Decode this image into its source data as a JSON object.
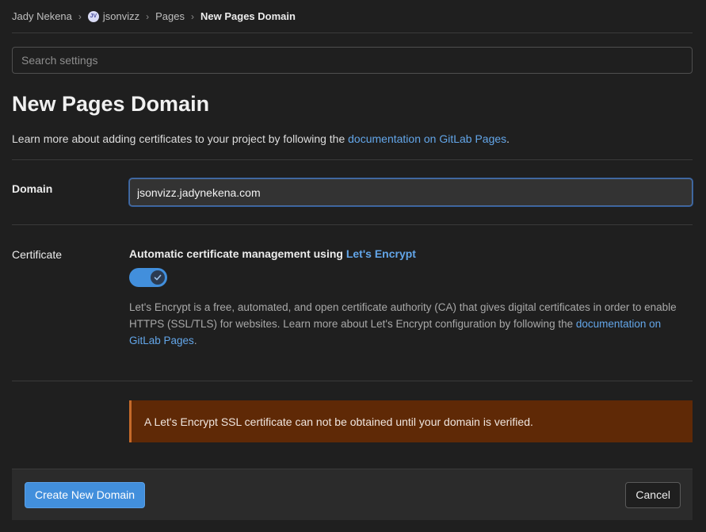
{
  "breadcrumb": {
    "items": [
      {
        "label": "Jady Nekena"
      },
      {
        "label": "jsonvizz",
        "avatar": "JV"
      },
      {
        "label": "Pages"
      },
      {
        "label": "New Pages Domain"
      }
    ],
    "separator": "›"
  },
  "search": {
    "placeholder": "Search settings"
  },
  "page": {
    "title": "New Pages Domain",
    "intro_text": "Learn more about adding certificates to your project by following the ",
    "intro_link": "documentation on GitLab Pages",
    "intro_end": "."
  },
  "domain": {
    "label": "Domain",
    "value": "jsonvizz.jadynekena.com"
  },
  "certificate": {
    "label": "Certificate",
    "title_text": "Automatic certificate management using ",
    "title_link": "Let's Encrypt",
    "toggle_on": true,
    "help_text": "Let's Encrypt is a free, automated, and open certificate authority (CA) that gives digital certificates in order to enable HTTPS (SSL/TLS) for websites. Learn more about Let's Encrypt configuration by following the ",
    "help_link": "documentation on GitLab Pages",
    "help_end": "."
  },
  "alert": {
    "text": "A Let's Encrypt SSL certificate can not be obtained until your domain is verified."
  },
  "footer": {
    "create_label": "Create New Domain",
    "cancel_label": "Cancel"
  },
  "colors": {
    "accent": "#428fdc",
    "link": "#63a6e9",
    "warning_bg": "#5f2906"
  }
}
